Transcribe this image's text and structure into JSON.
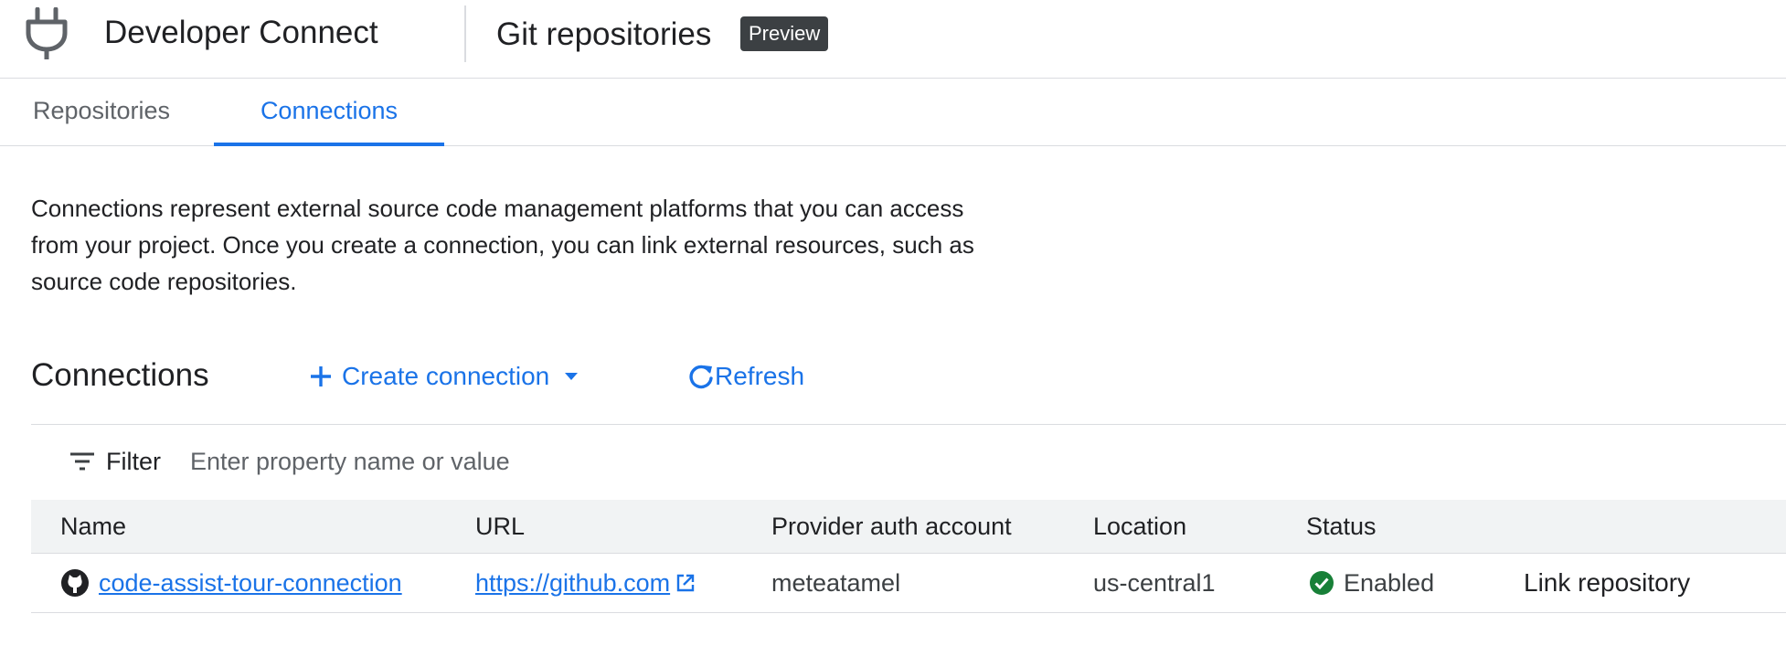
{
  "header": {
    "product_name": "Developer Connect",
    "page_title": "Git repositories",
    "badge": "Preview"
  },
  "tabs": [
    {
      "label": "Repositories",
      "active": false
    },
    {
      "label": "Connections",
      "active": true
    }
  ],
  "description": "Connections represent external source code management platforms that you can access from your project. Once you create a connection, you can link external resources, such as source code repositories.",
  "section": {
    "title": "Connections",
    "create_label": "Create connection",
    "refresh_label": "Refresh"
  },
  "filter": {
    "label": "Filter",
    "placeholder": "Enter property name or value"
  },
  "table": {
    "columns": [
      "Name",
      "URL",
      "Provider auth account",
      "Location",
      "Status"
    ],
    "rows": [
      {
        "name": "code-assist-tour-connection",
        "url": "https://github.com",
        "account": "meteatamel",
        "location": "us-central1",
        "status": "Enabled",
        "action": "Link repository"
      }
    ]
  },
  "icons": {
    "header": "plug-icon",
    "create": "plus-icon",
    "create_menu": "caret-down-icon",
    "refresh": "refresh-icon",
    "filter": "filter-icon",
    "provider": "github-icon",
    "external_link": "external-link-icon",
    "status": "check-circle-icon"
  },
  "colors": {
    "accent": "#1a73e8",
    "status_enabled": "#188038",
    "badge_bg": "#3c4043"
  }
}
